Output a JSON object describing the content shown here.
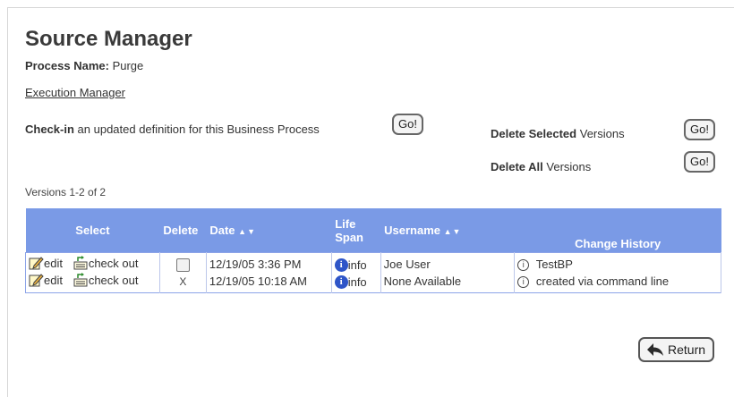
{
  "page": {
    "title": "Source Manager",
    "process_label": "Process Name:",
    "process_value": "Purge",
    "exec_link": "Execution Manager",
    "versions_count": "Versions 1-2 of 2"
  },
  "checkin": {
    "bold": "Check-in",
    "rest": "an updated definition for this Business Process",
    "go": "Go!"
  },
  "delete_selected": {
    "bold": "Delete Selected",
    "rest": "Versions",
    "go": "Go!"
  },
  "delete_all": {
    "bold": "Delete All",
    "rest": "Versions",
    "go": "Go!"
  },
  "table": {
    "headers": {
      "select": "Select",
      "delete": "Delete",
      "date": "Date",
      "life_span_1": "Life",
      "life_span_2": "Span",
      "username": "Username",
      "change_history": "Change History",
      "sort_arrows": "▲▼"
    },
    "rows": [
      {
        "edit": "edit",
        "checkout": "check out",
        "delete_state": "checkbox",
        "date": "12/19/05 3:36 PM",
        "info": "info",
        "username": "Joe User",
        "change": "TestBP"
      },
      {
        "edit": "edit",
        "checkout": "check out",
        "delete_state": "x",
        "delete_mark": "X",
        "date": "12/19/05 10:18 AM",
        "info": "info",
        "username": "None Available",
        "change": "created via command line"
      }
    ]
  },
  "return_button": "Return",
  "colors": {
    "header_bg": "#7a9ae6",
    "info_blue": "#2e55c8"
  }
}
